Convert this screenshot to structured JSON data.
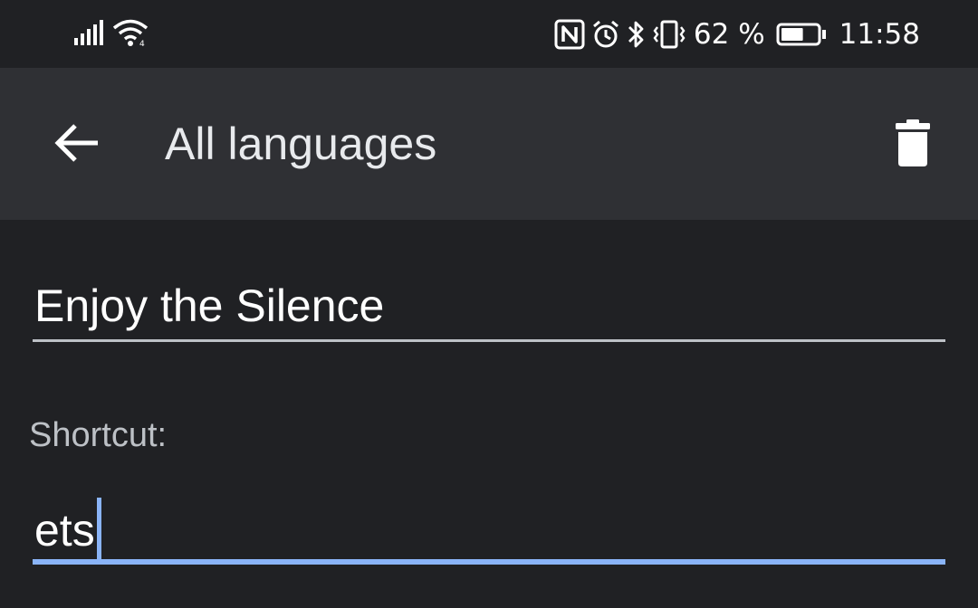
{
  "status_bar": {
    "battery_percent": "62 %",
    "time": "11:58",
    "icons": [
      "signal-icon",
      "wifi-icon",
      "nfc-icon",
      "alarm-icon",
      "bluetooth-icon",
      "vibrate-icon",
      "battery-icon"
    ],
    "battery_level": 0.62
  },
  "app_bar": {
    "title": "All languages",
    "back_icon": "arrow-back-icon",
    "delete_icon": "trash-icon"
  },
  "form": {
    "phrase_value": "Enjoy the Silence",
    "shortcut_label": "Shortcut:",
    "shortcut_value": "ets"
  },
  "colors": {
    "background": "#202124",
    "app_bar": "#2f3034",
    "accent": "#8ab4f8",
    "text_primary": "#ffffff",
    "text_secondary": "#bdc1c6"
  }
}
